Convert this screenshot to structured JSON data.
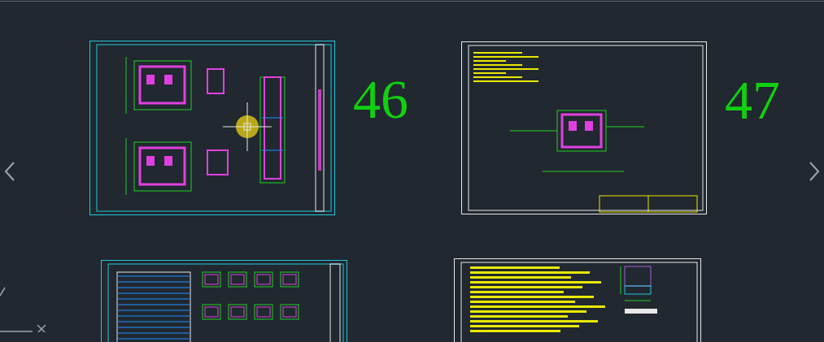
{
  "sheets": [
    {
      "kind": "plan",
      "number": "46"
    },
    {
      "kind": "detail",
      "number": "47"
    },
    {
      "kind": "schedule"
    },
    {
      "kind": "notes"
    }
  ]
}
